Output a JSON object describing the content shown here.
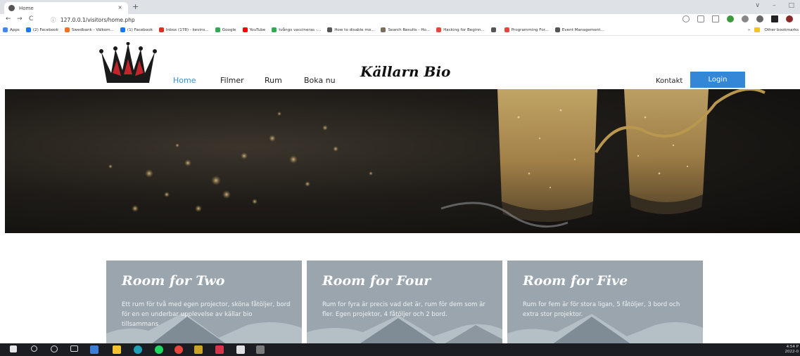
{
  "browser": {
    "tab_title": "Home",
    "tab_close": "×",
    "new_tab": "+",
    "url": "127.0.0.1/visitors/home.php",
    "nav": {
      "back": "←",
      "forward": "→",
      "reload": "C",
      "info": "ⓘ"
    },
    "window_controls": [
      "∨",
      "–",
      "□"
    ],
    "bookmarks": [
      {
        "label": "Apps",
        "color": "#4285f4"
      },
      {
        "label": "(2) Facebook",
        "color": "#1877f2"
      },
      {
        "label": "Swedbank - Välkom...",
        "color": "#f27022"
      },
      {
        "label": "(1) Facebook",
        "color": "#1877f2"
      },
      {
        "label": "Inbox (178) - kevins...",
        "color": "#d93025"
      },
      {
        "label": "Google",
        "color": "#34a853"
      },
      {
        "label": "YouTube",
        "color": "#ff0000"
      },
      {
        "label": "tvångs vaccineras -...",
        "color": "#34a853"
      },
      {
        "label": "How to disable mo...",
        "color": "#555555"
      },
      {
        "label": "Search Results - Ho...",
        "color": "#7b6e5a"
      },
      {
        "label": "Hacking for Beginn...",
        "color": "#e8453c"
      },
      {
        "label": "",
        "color": "#555555"
      },
      {
        "label": "Programming For...",
        "color": "#e8453c"
      },
      {
        "label": "Event Management...",
        "color": "#555555"
      }
    ],
    "bookmarks_more": "»",
    "other_bookmarks": "Other bookmarks"
  },
  "site": {
    "brand": "Källarn Bio",
    "nav": {
      "home": "Home",
      "filmer": "Filmer",
      "rum": "Rum",
      "boka": "Boka nu",
      "kontakt": "Kontakt",
      "login": "Login"
    },
    "rooms": [
      {
        "title": "Room for Two",
        "text": "Ett rum för två med egen projector, sköna fåtöljer, bord för en en underbar upplevelse av källar bio tillsammans"
      },
      {
        "title": "Room for Four",
        "text": "Rum for fyra är precis vad det är, rum för dem som är fler. Egen projektor, 4 fåtöljer och 2 bord."
      },
      {
        "title": "Room for Five",
        "text": "Rum for fem är för stora ligan, 5 fåtöljer, 3 bord och extra stor projektor."
      }
    ]
  },
  "taskbar": {
    "time": "4:54 P",
    "date": "2022-0"
  },
  "colors": {
    "accent": "#3486d6",
    "active_nav": "#3a8fd6",
    "card_bg": "#9aa5ad"
  }
}
